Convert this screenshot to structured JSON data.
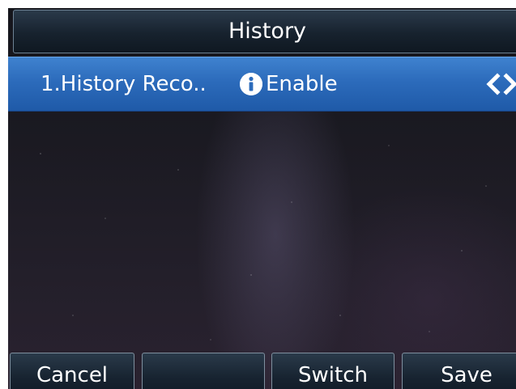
{
  "header": {
    "title": "History"
  },
  "selected_item": {
    "label": "1.History Reco..",
    "value": "Enable",
    "info_icon": "info-icon",
    "nav_icon": "left-right-arrows-icon"
  },
  "softkeys": {
    "key1": "Cancel",
    "key2": "",
    "key3": "Switch",
    "key4": "Save"
  },
  "colors": {
    "selected_row": "#2c6bbb",
    "title_bar": "#17222e"
  }
}
